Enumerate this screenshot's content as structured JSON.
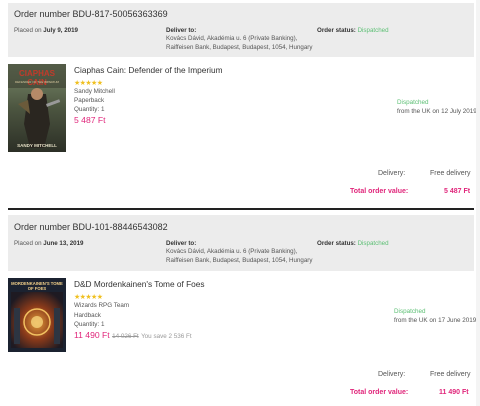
{
  "orders": [
    {
      "number_label": "Order number BDU-817-50056363369",
      "placed_prefix": "Placed on ",
      "placed_date": "July 9, 2019",
      "deliver_label": "Deliver to:",
      "address_line1": "Kovács Dávid, Akadémia u. 6 (Private Banking),",
      "address_line2": "Raiffeisen Bank, Budapest, Budapest, 1054, Hungary",
      "status_label": "Order status:",
      "status_value": "Dispatched",
      "item": {
        "title": "Ciaphas Cain: Defender of the Imperium",
        "rating_stars": "★★★★★",
        "author": "Sandy Mitchell",
        "format": "Paperback",
        "quantity": "Quantity: 1",
        "price": "5 487 Ft",
        "old_price": "",
        "save_text": "",
        "ship_status": "Dispatched",
        "ship_from": "from the UK on 12 July 2019",
        "cover_title": "CIAPHAS CAIN",
        "cover_sub": "DEFENDER OF THE IMPERIUM",
        "cover_author": "SANDY MITCHELL"
      },
      "delivery_label": "Delivery:",
      "delivery_value": "Free delivery",
      "total_label": "Total order value:",
      "total_value": "5 487 Ft"
    },
    {
      "number_label": "Order number BDU-101-88446543082",
      "placed_prefix": "Placed on ",
      "placed_date": "June 13, 2019",
      "deliver_label": "Deliver to:",
      "address_line1": "Kovács Dávid, Akadémia u. 6 (Private Banking),",
      "address_line2": "Raiffeisen Bank, Budapest, Budapest, 1054, Hungary",
      "status_label": "Order status:",
      "status_value": "Dispatched",
      "item": {
        "title": "D&D Mordenkainen's Tome of Foes",
        "rating_stars": "★★★★★",
        "author": "Wizards RPG Team",
        "format": "Hardback",
        "quantity": "Quantity: 1",
        "price": "11 490 Ft",
        "old_price": "14 026 Ft",
        "save_text": "You save 2 536 Ft",
        "ship_status": "Dispatched",
        "ship_from": "from the UK on 17 June 2019",
        "cover_title": "MORDENKAINEN'S TOME OF FOES",
        "cover_sub": "",
        "cover_author": ""
      },
      "delivery_label": "Delivery:",
      "delivery_value": "Free delivery",
      "total_label": "Total order value:",
      "total_value": "11 490 Ft"
    }
  ],
  "colors": {
    "accent_pink": "#e0257a",
    "status_green": "#5bbf73",
    "star_yellow": "#f0c020",
    "header_gray": "#ececec"
  }
}
